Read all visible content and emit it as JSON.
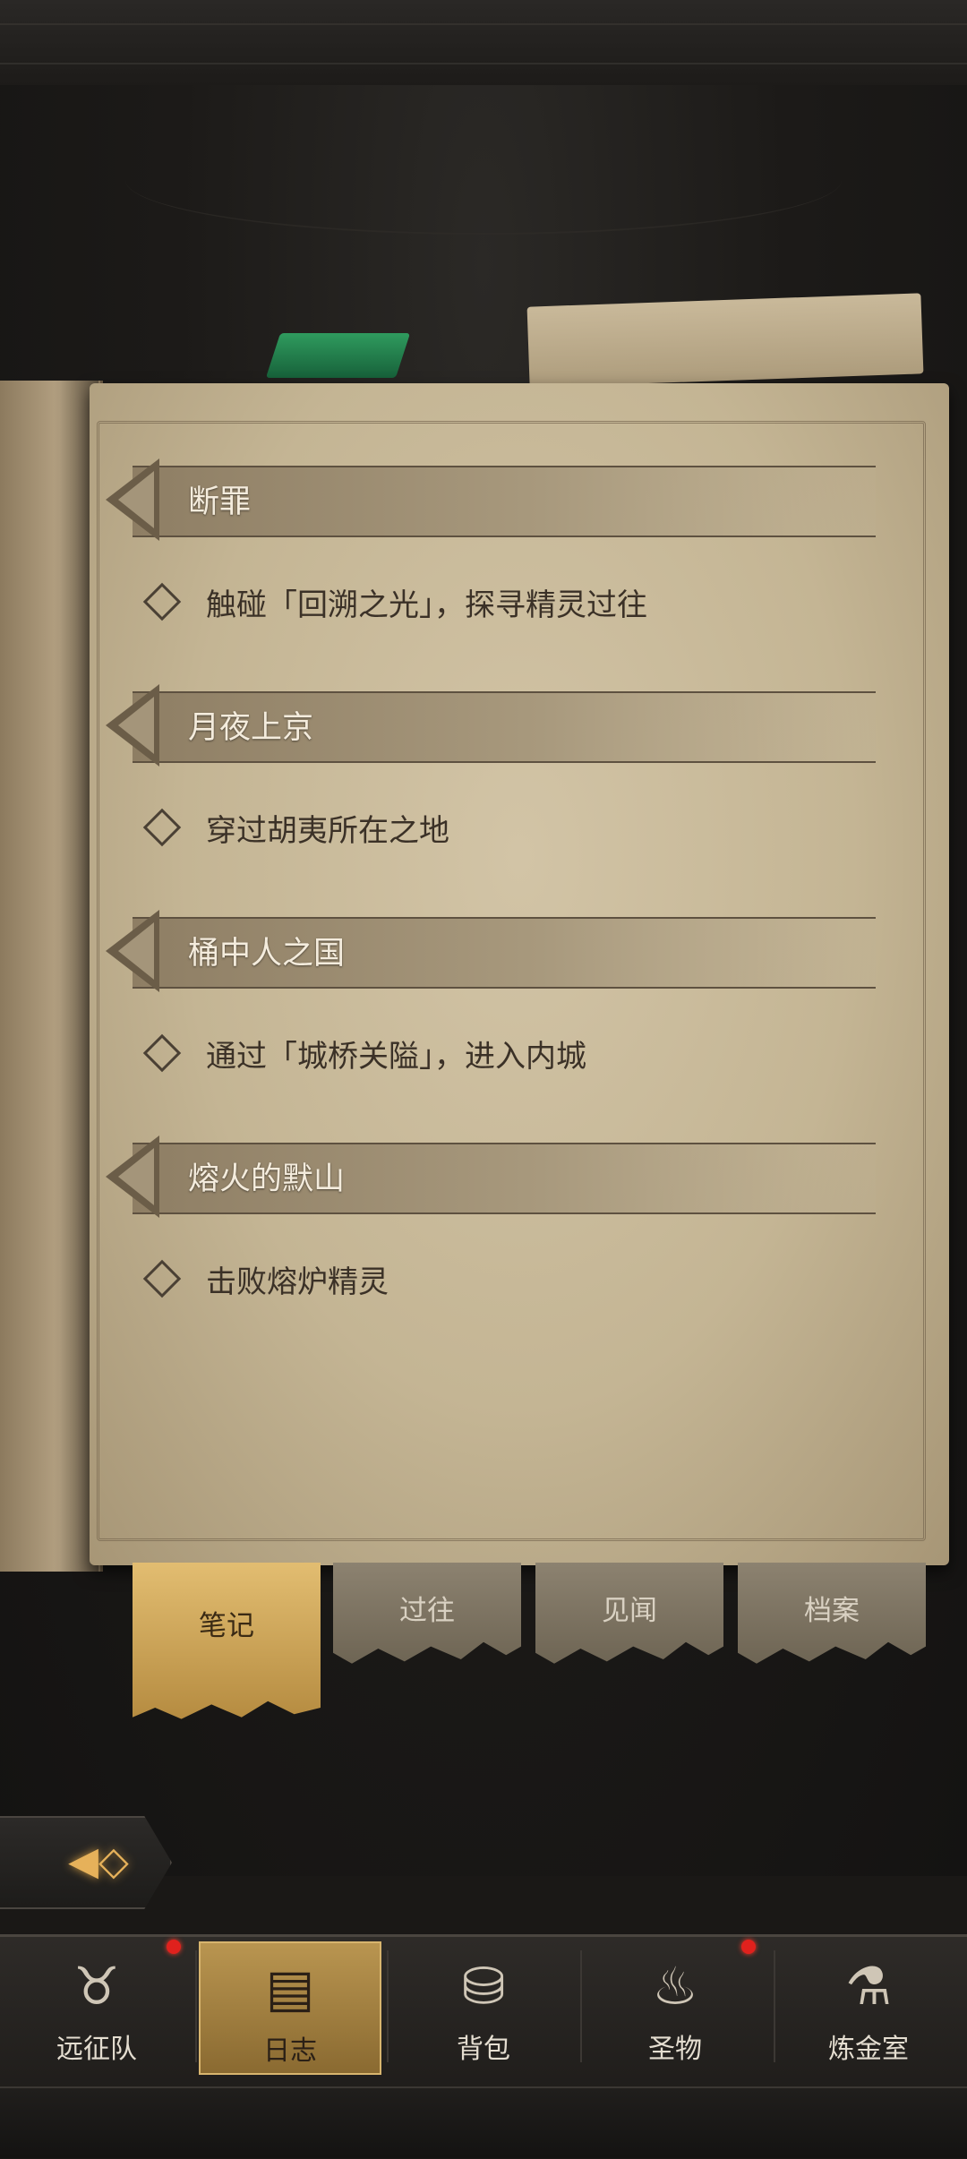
{
  "journal": {
    "entries": [
      {
        "title": "断罪",
        "objective": "触碰「回溯之光」，探寻精灵过往"
      },
      {
        "title": "月夜上京",
        "objective": "穿过胡夷所在之地"
      },
      {
        "title": "桶中人之国",
        "objective": "通过「城桥关隘」，进入内城"
      },
      {
        "title": "熔火的默山",
        "objective": "击败熔炉精灵"
      }
    ]
  },
  "tabs": [
    {
      "label": "笔记",
      "active": true
    },
    {
      "label": "过往",
      "active": false
    },
    {
      "label": "见闻",
      "active": false
    },
    {
      "label": "档案",
      "active": false
    }
  ],
  "nav": {
    "items": [
      {
        "label": "远征队",
        "icon": "horned-helmet-icon",
        "badge": true
      },
      {
        "label": "日志",
        "icon": "journal-icon",
        "active": true
      },
      {
        "label": "背包",
        "icon": "backpack-icon"
      },
      {
        "label": "圣物",
        "icon": "brazier-icon",
        "badge": true
      },
      {
        "label": "炼金室",
        "icon": "alchemy-icon"
      }
    ]
  },
  "colors": {
    "active_tab": "#d9b36a",
    "notification_dot": "#e0211d",
    "back_arrow": "#e6b15a"
  }
}
